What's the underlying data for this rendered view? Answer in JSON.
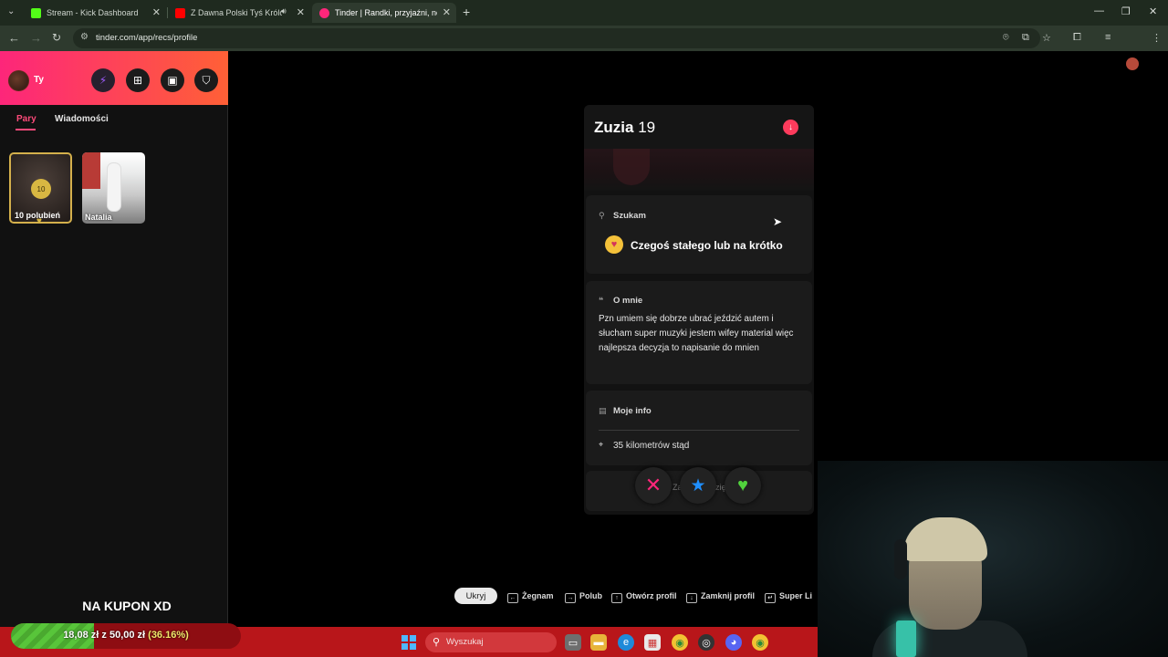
{
  "browser": {
    "tabs": [
      {
        "title": "Stream - Kick Dashboard",
        "favicon_color": "#53fc18"
      },
      {
        "title": "Z Dawna Polski Tyś Królową",
        "favicon_color": "#ff0000"
      },
      {
        "title": "Tinder | Randki, przyjaźni, nowe",
        "favicon_color": "#fd267a"
      }
    ],
    "url": "tinder.com/app/recs/profile"
  },
  "sidebar": {
    "me_label": "Ty",
    "tabs": {
      "pary": "Pary",
      "messages": "Wiadomości"
    },
    "likes": {
      "count": "10",
      "label": "10 polubień"
    },
    "match_name": "Natalia",
    "stream_text": "NA KUPON XD"
  },
  "profile": {
    "name": "Zuzia",
    "age": "19",
    "looking_title": "Szukam",
    "looking_value": "Czegoś stałego lub na krótko",
    "about_title": "O mnie",
    "about_text": "Pzn umiem się dobrze ubrać jeździć autem i słucham super muzyki jestem wifey material więc najlepsza decyzja to napisanie do mnien",
    "info_title": "Moje info",
    "distance": "35 kilometrów stąd",
    "more_text": "Zablokuj Zuzię"
  },
  "shortcuts": {
    "hide_label": "Ukryj",
    "items": [
      "Żegnam",
      "Polub",
      "Otwórz profil",
      "Zamknij profil",
      "Super Li"
    ]
  },
  "donation": {
    "current": "18,08 zł",
    "separator": "z",
    "goal": "50,00 zł",
    "percent_text": "(36.16%)",
    "progress": 0.3616
  },
  "taskbar": {
    "search_placeholder": "Wyszukaj"
  },
  "colors": {
    "tinder_gradient_start": "#fd267a",
    "tinder_gradient_end": "#ff6036",
    "nope": "#fd267a",
    "superlike": "#1f8fff",
    "like": "#51d33d",
    "taskbar": "#b8161a"
  }
}
